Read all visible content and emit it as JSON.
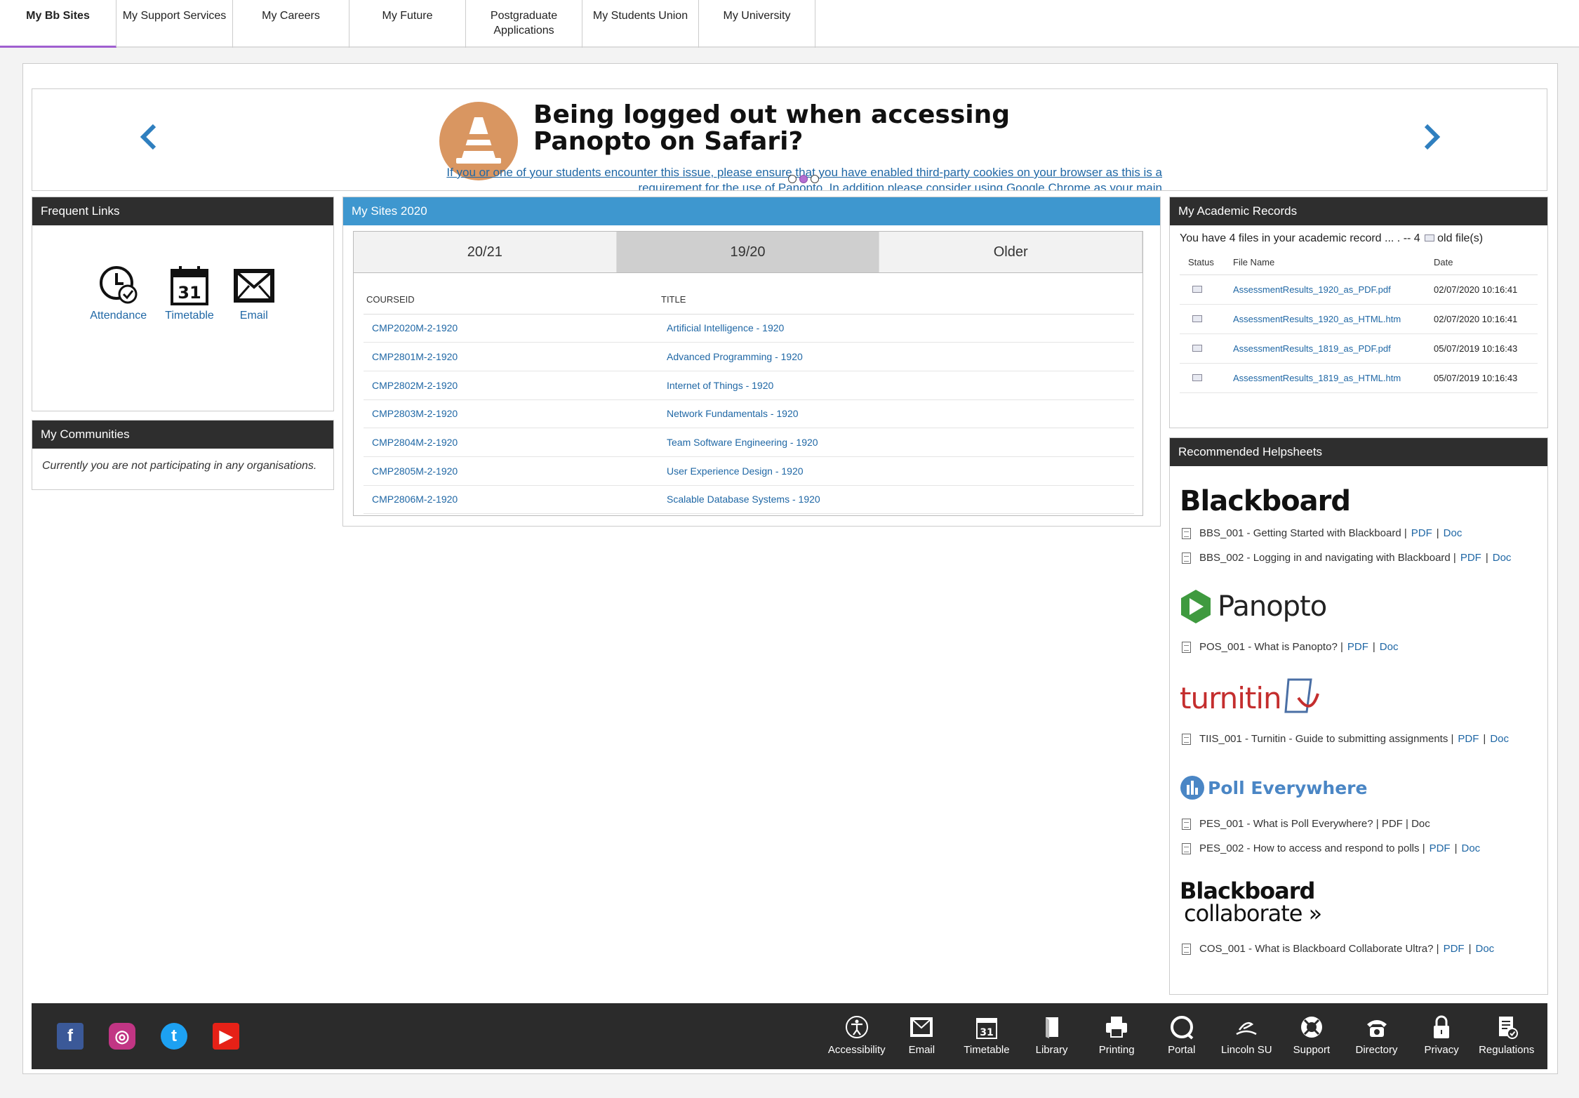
{
  "tabs": [
    "My Bb Sites",
    "My Support Services",
    "My Careers",
    "My Future",
    "Postgraduate Applications",
    "My Students Union",
    "My University"
  ],
  "banner": {
    "title": "Being logged out when accessing Panopto on Safari?",
    "message": "If you or one of your students encounter this issue, please ensure that you have enabled third-party cookies on your browser as this is a requirement for the use of Panopto. In addition please consider using Google Chrome as your main",
    "prev_icon": "chevron-left-icon",
    "next_icon": "chevron-right-icon",
    "slide_count": 3,
    "active_slide": 2
  },
  "frequent_links": {
    "title": "Frequent Links",
    "items": [
      {
        "label": "Attendance",
        "icon": "attendance-icon"
      },
      {
        "label": "Timetable",
        "icon": "calendar-icon"
      },
      {
        "label": "Email",
        "icon": "email-icon"
      }
    ]
  },
  "communities": {
    "title": "My Communities",
    "empty_text": "Currently you are not participating in any organisations."
  },
  "sites": {
    "title": "My Sites 2020",
    "tabs": [
      "20/21",
      "19/20",
      "Older"
    ],
    "selected_tab": "19/20",
    "headers": [
      "COURSEID",
      "TITLE"
    ],
    "rows": [
      [
        "CMP2020M-2-1920",
        "Artificial Intelligence - 1920"
      ],
      [
        "CMP2801M-2-1920",
        "Advanced Programming - 1920"
      ],
      [
        "CMP2802M-2-1920",
        "Internet of Things - 1920"
      ],
      [
        "CMP2803M-2-1920",
        "Network Fundamentals - 1920"
      ],
      [
        "CMP2804M-2-1920",
        "Team Software Engineering - 1920"
      ],
      [
        "CMP2805M-2-1920",
        "User Experience Design - 1920"
      ],
      [
        "CMP2806M-2-1920",
        "Scalable Database Systems - 1920"
      ]
    ]
  },
  "records": {
    "title": "My Academic Records",
    "summary_prefix": "You have 4 files in your academic record ... . -- 4",
    "summary_suffix": "old file(s)",
    "headers": [
      "Status",
      "File Name",
      "Date"
    ],
    "rows": [
      [
        "AssessmentResults_1920_as_PDF.pdf",
        "02/07/2020 10:16:41"
      ],
      [
        "AssessmentResults_1920_as_HTML.htm",
        "02/07/2020 10:16:41"
      ],
      [
        "AssessmentResults_1819_as_PDF.pdf",
        "05/07/2019 10:16:43"
      ],
      [
        "AssessmentResults_1819_as_HTML.htm",
        "05/07/2019 10:16:43"
      ]
    ]
  },
  "helpsheets": {
    "title": "Recommended Helpsheets",
    "pdf": "PDF",
    "doc": "Doc",
    "sep": "|",
    "logos": {
      "blackboard": "Blackboard",
      "panopto": "Panopto",
      "turnitin": "turnitin",
      "poll": "Poll Everywhere",
      "collab1": "Blackboard",
      "collab2": "collaborate"
    },
    "bbs1": "BBS_001 - Getting Started with Blackboard",
    "bbs2": "BBS_002 - Logging in and navigating with Blackboard",
    "pos1": "POS_001 - What is Panopto?",
    "tiis1": "TIIS_001 - Turnitin - Guide to submitting assignments",
    "pes1": "PES_001 - What is Poll Everywhere? | PDF | Doc",
    "pes2": "PES_002 - How to access and respond to polls",
    "cos1": "COS_001 - What is Blackboard Collaborate Ultra?"
  },
  "footer": {
    "social": [
      {
        "icon": "facebook-icon",
        "glyph": "f",
        "color": "#3b5998"
      },
      {
        "icon": "instagram-icon",
        "glyph": "◎",
        "color": "#c13584"
      },
      {
        "icon": "twitter-icon",
        "glyph": "t",
        "color": "#1da1f2"
      },
      {
        "icon": "youtube-icon",
        "glyph": "▶",
        "color": "#e62117"
      }
    ],
    "links": [
      "Accessibility",
      "Email",
      "Timetable",
      "Library",
      "Printing",
      "Portal",
      "Lincoln SU",
      "Support",
      "Directory",
      "Privacy",
      "Regulations"
    ]
  }
}
